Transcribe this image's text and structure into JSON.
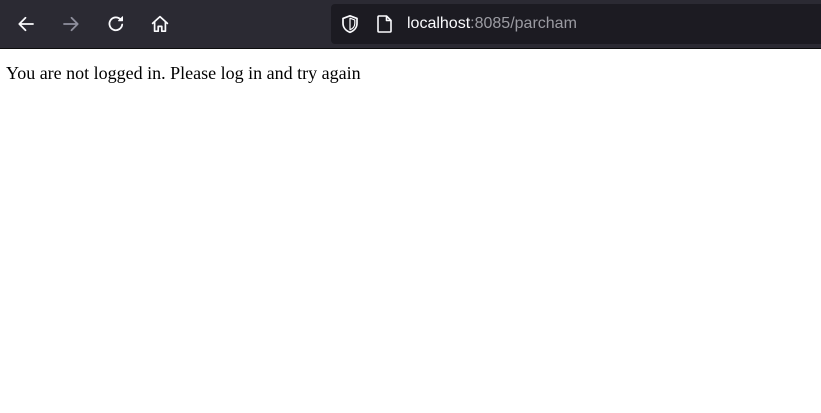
{
  "browser": {
    "toolbar": {
      "back_icon": "arrow-left-icon",
      "forward_icon": "arrow-right-icon",
      "reload_icon": "reload-icon",
      "home_icon": "home-icon"
    },
    "urlbar": {
      "host": "localhost",
      "rest": ":8085/parcham",
      "shield_icon": "shield-icon",
      "page_icon": "page-icon"
    },
    "colors": {
      "toolbar_bg": "#2b2a33",
      "urlbar_bg": "#1c1b22",
      "icon_active": "#fbfbfe",
      "icon_disabled": "#8f8f9d"
    }
  },
  "page": {
    "message": "You are not logged in. Please log in and try again"
  }
}
